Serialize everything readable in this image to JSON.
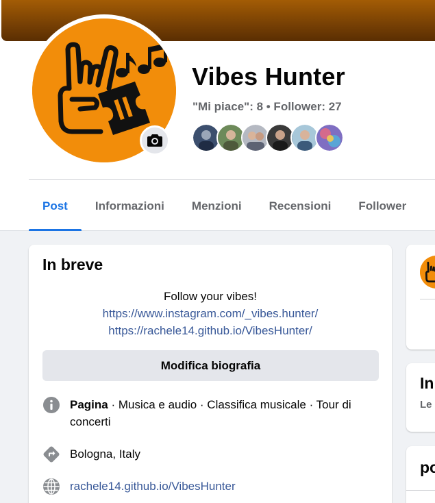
{
  "page": {
    "name": "Vibes Hunter",
    "stats": "\"Mi piace\": 8 • Follower: 27"
  },
  "followers": [
    {
      "name": "follower-1",
      "color": "#3c4f6e"
    },
    {
      "name": "follower-2",
      "color": "#6d8a5a"
    },
    {
      "name": "follower-3",
      "color": "#b5b9c2"
    },
    {
      "name": "follower-4",
      "color": "#3a3a3a"
    },
    {
      "name": "follower-5",
      "color": "#a7c7d9"
    },
    {
      "name": "follower-6",
      "color": "#7f6ec2"
    }
  ],
  "tabs": [
    {
      "label": "Post",
      "active": true
    },
    {
      "label": "Informazioni",
      "active": false
    },
    {
      "label": "Menzioni",
      "active": false
    },
    {
      "label": "Recensioni",
      "active": false
    },
    {
      "label": "Follower",
      "active": false
    }
  ],
  "intro": {
    "title": "In breve",
    "bio_text": "Follow your vibes!",
    "bio_link1": "https://www.instagram.com/_vibes.hunter/",
    "bio_link2": "https://rachele14.github.io/VibesHunter/",
    "edit_bio_label": "Modifica biografia",
    "category_strong": "Pagina",
    "category_rest": " · Musica e audio · Classifica musicale · Tour di concerti",
    "location": "Bologna, Italy",
    "website": "rachele14.github.io/VibesHunter"
  },
  "right": {
    "card2_title": "In",
    "card2_sub": "Le",
    "card3_title": "po"
  },
  "colors": {
    "accent": "#1b74e4",
    "brand_orange": "#f28d0a",
    "cover_brown": "#7a4204",
    "link": "#385898"
  },
  "icons": {
    "camera": "camera-icon",
    "category": "info-icon",
    "location": "directions-icon",
    "website": "globe-icon"
  }
}
